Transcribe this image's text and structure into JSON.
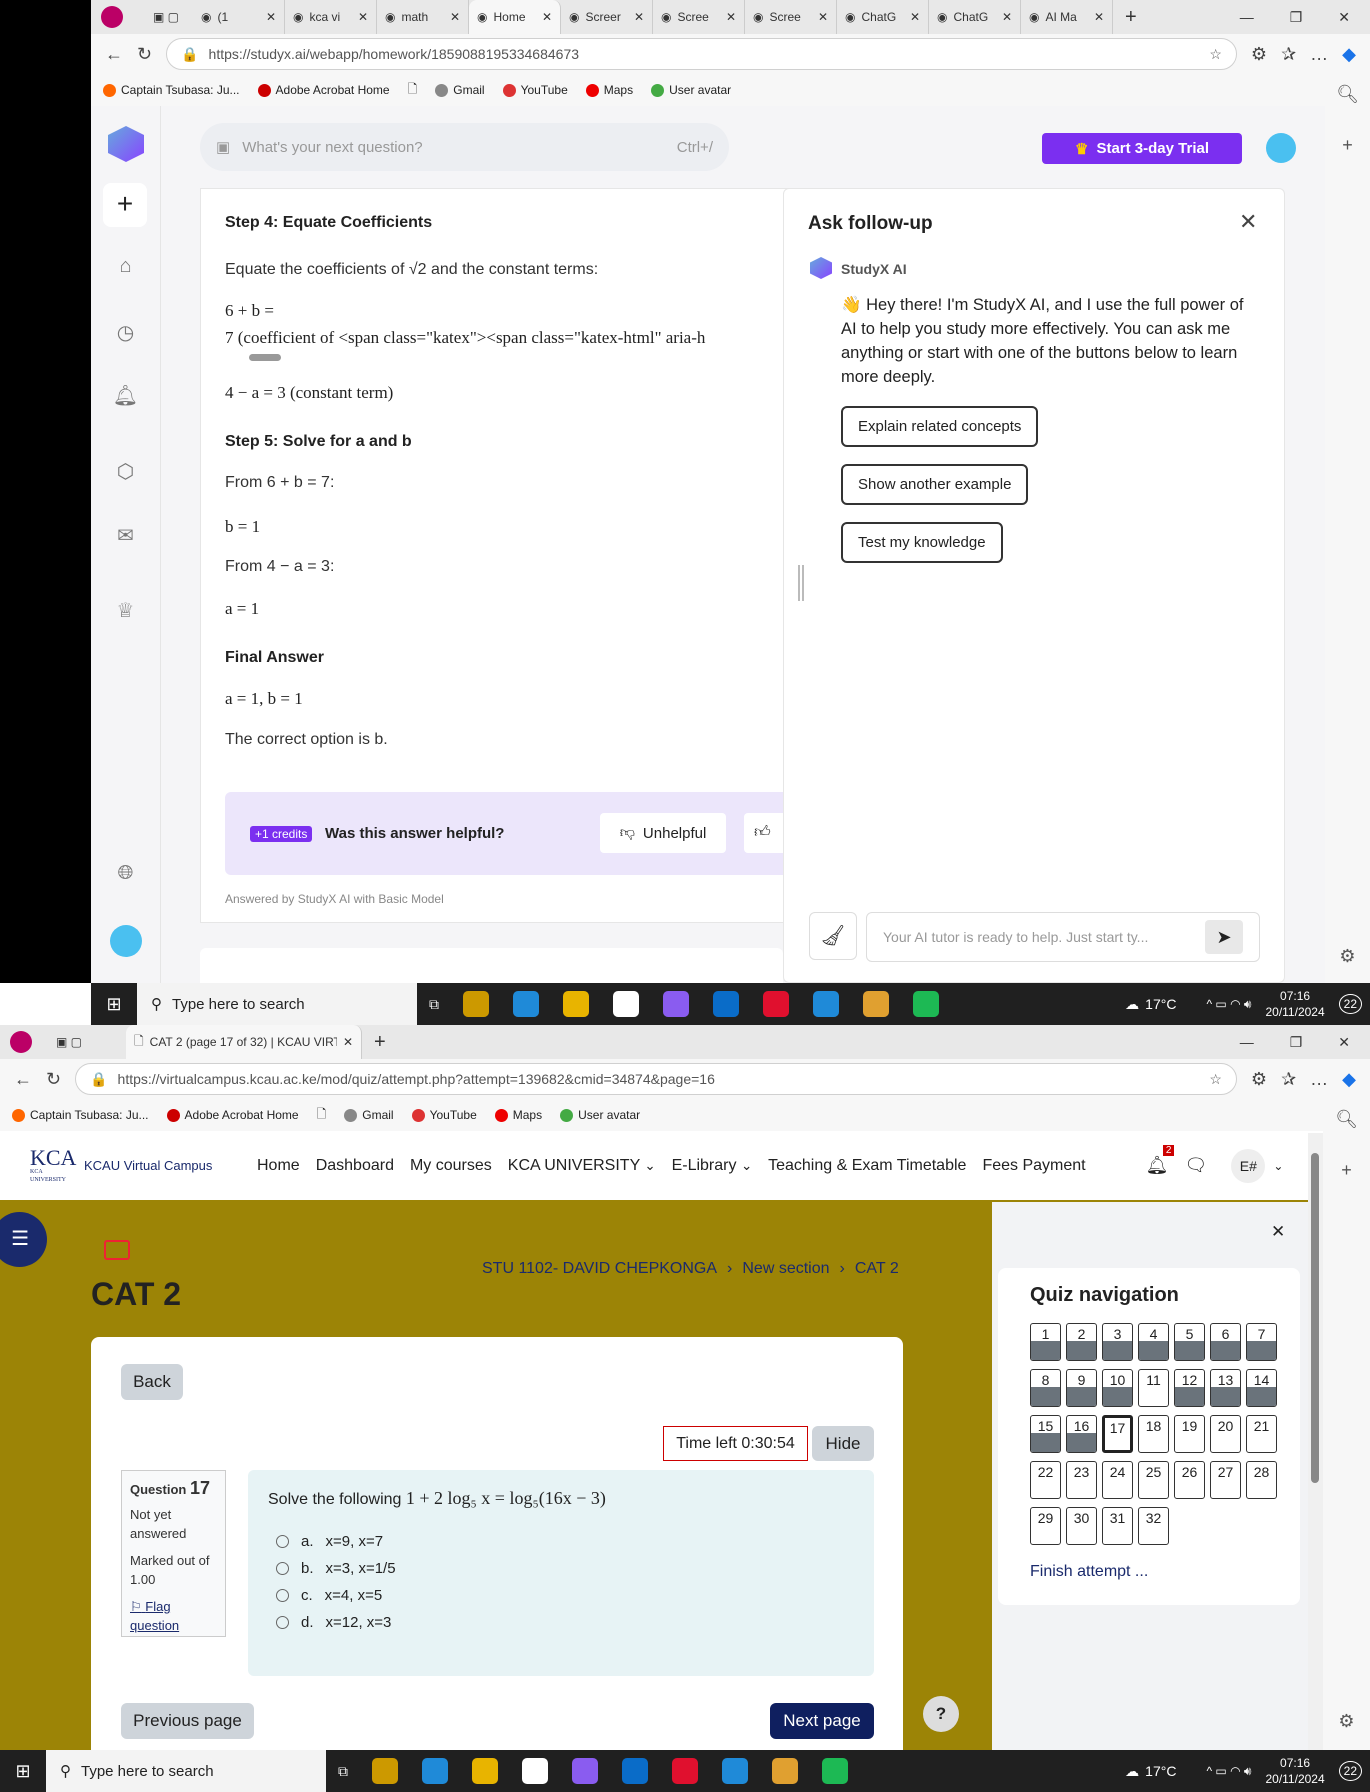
{
  "browser1": {
    "tabs": [
      "(1",
      "kca vi",
      "math",
      "Home",
      "Screer",
      "Scree",
      "Scree",
      "ChatG",
      "ChatG",
      "AI Ma"
    ],
    "url": "https://studyx.ai/webapp/homework/1859088195334684673"
  },
  "bookmarks": [
    "Captain Tsubasa: Ju...",
    "Adobe Acrobat Home",
    "Gmail",
    "YouTube",
    "Maps",
    "User avatar"
  ],
  "studyx": {
    "search_placeholder": "What's your next question?",
    "shortcut": "Ctrl+/",
    "trial": "Start 3-day Trial",
    "step4_title": "Step 4: Equate Coefficients",
    "step4_text": "Equate the coefficients of √2 and the constant terms:",
    "eq1a": "6 + b =",
    "eq1b": "7   (coefficient of <span class=\"katex\"><span class=\"katex-html\" aria-h",
    "eq2": "4 − a = 3   (constant term)",
    "step5_title": "Step 5: Solve for a and b",
    "from1": "From 6 + b = 7:",
    "b_res": "b = 1",
    "from2": "From 4 − a = 3:",
    "a_res": "a = 1",
    "final_title": "Final Answer",
    "final": "a = 1, b = 1",
    "correct": "The correct option is b.",
    "credits": "+1 credits",
    "helpful": "Was this answer helpful?",
    "unhelpful": "Unhelpful",
    "answered_by": "Answered by StudyX AI with Basic Model"
  },
  "followup": {
    "title": "Ask follow-up",
    "bot": "StudyX AI",
    "message": "👋 Hey there! I'm StudyX AI, and I use the full power of AI to help you study more effectively. You can ask me anything or start with one of the buttons below to learn more deeply.",
    "buttons": [
      "Explain related concepts",
      "Show another example",
      "Test my knowledge"
    ],
    "input_placeholder": "Your AI tutor is ready to help. Just start ty..."
  },
  "taskbar": {
    "search": "Type here to search",
    "temp": "17°C",
    "time": "07:16",
    "date": "20/11/2024",
    "notif": "22"
  },
  "browser2": {
    "tab": "CAT 2 (page 17 of 32) | KCAU VIRT",
    "url": "https://virtualcampus.kcau.ac.ke/mod/quiz/attempt.php?attempt=139682&cmid=34874&page=16"
  },
  "kcau": {
    "site": "KCAU Virtual Campus",
    "logo": "KCA UNIVERSITY",
    "nav": [
      "Home",
      "Dashboard",
      "My courses",
      "KCA UNIVERSITY",
      "E-Library",
      "Teaching & Exam Timetable",
      "Fees Payment"
    ],
    "notif_count": "2",
    "user": "E#",
    "title": "CAT 2",
    "breadcrumb": [
      "STU 1102- DAVID CHEPKONGA",
      "New section",
      "CAT 2"
    ],
    "back": "Back",
    "time_left": "Time left 0:30:54",
    "hide": "Hide",
    "question": {
      "label": "Question",
      "number": "17",
      "status": "Not yet answered",
      "marked": "Marked out of 1.00",
      "flag": "Flag question",
      "text": "Solve the following",
      "formula": "1 + 2 log₅ x = log₅(16x − 3)",
      "options": [
        {
          "letter": "a.",
          "text": "x=9, x=7"
        },
        {
          "letter": "b.",
          "text": "x=3, x=1/5"
        },
        {
          "letter": "c.",
          "text": "x=4, x=5"
        },
        {
          "letter": "d.",
          "text": "x=12, x=3"
        }
      ]
    },
    "prev": "Previous page",
    "next": "Next page",
    "help": "?",
    "quiz_nav": {
      "title": "Quiz navigation",
      "answered": [
        1,
        2,
        3,
        4,
        5,
        6,
        7,
        8,
        9,
        10,
        12,
        13,
        14,
        15,
        16
      ],
      "current": 17,
      "total": 32,
      "finish": "Finish attempt ..."
    },
    "olive": "#9c8406"
  }
}
